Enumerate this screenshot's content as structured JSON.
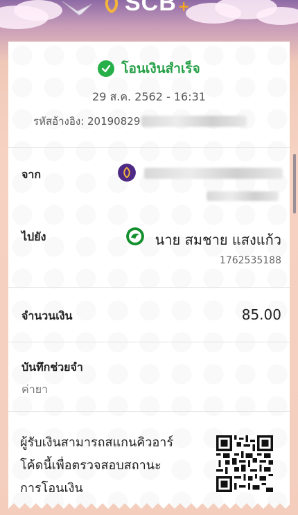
{
  "header": {
    "brand": "SCB",
    "brand_plus": "+",
    "logo_icon": "scb-lotus-icon",
    "bird_icon": "bird-illustration-icon"
  },
  "status": {
    "icon": "check-circle-icon",
    "text": "โอนเงินสำเร็จ",
    "color": "#27b04a"
  },
  "datetime": "29 ส.ค. 2562 - 16:31",
  "reference": {
    "label": "รหัสอ้างอิง: 20190829"
  },
  "from": {
    "label": "จาก",
    "bank_icon": "scb-bank-icon"
  },
  "to": {
    "label": "ไปยัง",
    "bank_icon": "kbank-bank-icon",
    "name": "นาย สมชาย แสงแก้ว",
    "account": "1762535188"
  },
  "amount": {
    "label": "จำนวนเงิน",
    "value": "85.00"
  },
  "memo": {
    "label": "บันทึกช่วยจำ",
    "value": "ค่ายา"
  },
  "qr": {
    "text_line1": "ผู้รับเงินสามารถสแกนคิวอาร์",
    "text_line2": "โค้ดนี้เพื่อตรวจสอบสถานะ",
    "text_line3": "การโอนเงิน",
    "icon": "qr-code-icon"
  }
}
